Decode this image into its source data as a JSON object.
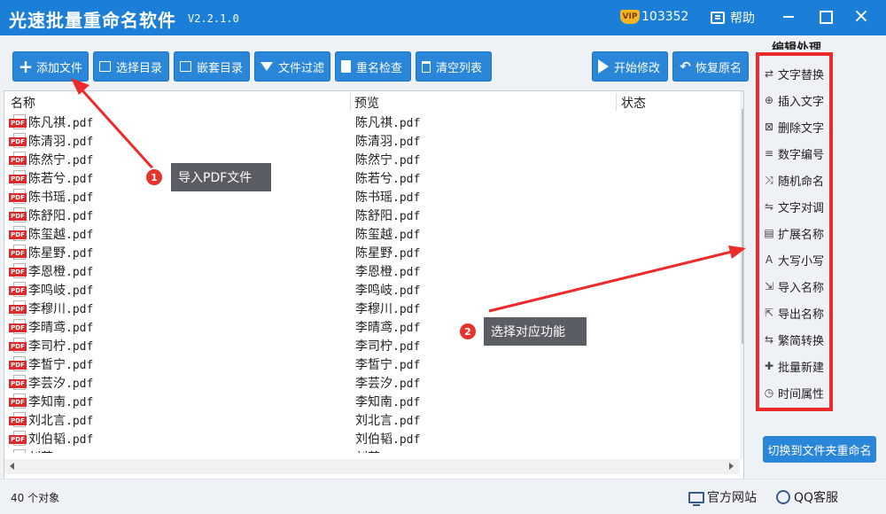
{
  "window": {
    "title": "光速批量重命名软件",
    "version": "V2.2.1.0",
    "vip_badge": "VIP",
    "vip_number": "103352",
    "help_label": "帮助",
    "close_glyph": "×"
  },
  "toolbar": {
    "add_file": "添加文件",
    "select_dir": "选择目录",
    "nested_dir": "嵌套目录",
    "file_filter": "文件过滤",
    "rename_check": "重名检查",
    "clear_list": "清空列表",
    "start_modify": "开始修改",
    "restore_name": "恢复原名",
    "icon_plus": "+",
    "icon_undo": "↶"
  },
  "filelist": {
    "headers": {
      "name": "名称",
      "preview": "预览",
      "status": "状态"
    },
    "file_icon_label": "PDF",
    "rows": [
      {
        "name": "陈凡祺",
        "ext": ".pdf",
        "preview": "陈凡祺",
        "preview_ext": ".pdf"
      },
      {
        "name": "陈清羽",
        "ext": ".pdf",
        "preview": "陈清羽",
        "preview_ext": ".pdf"
      },
      {
        "name": "陈然宁",
        "ext": ".pdf",
        "preview": "陈然宁",
        "preview_ext": ".pdf"
      },
      {
        "name": "陈若兮",
        "ext": ".pdf",
        "preview": "陈若兮",
        "preview_ext": ".pdf"
      },
      {
        "name": "陈书瑶",
        "ext": ".pdf",
        "preview": "陈书瑶",
        "preview_ext": ".pdf"
      },
      {
        "name": "陈舒阳",
        "ext": ".pdf",
        "preview": "陈舒阳",
        "preview_ext": ".pdf"
      },
      {
        "name": "陈玺越",
        "ext": ".pdf",
        "preview": "陈玺越",
        "preview_ext": ".pdf"
      },
      {
        "name": "陈星野",
        "ext": ".pdf",
        "preview": "陈星野",
        "preview_ext": ".pdf"
      },
      {
        "name": "李恩橙",
        "ext": ".pdf",
        "preview": "李恩橙",
        "preview_ext": ".pdf"
      },
      {
        "name": "李鸣岐",
        "ext": ".pdf",
        "preview": "李鸣岐",
        "preview_ext": ".pdf"
      },
      {
        "name": "李穆川",
        "ext": ".pdf",
        "preview": "李穆川",
        "preview_ext": ".pdf"
      },
      {
        "name": "李晴鸢",
        "ext": ".pdf",
        "preview": "李晴鸢",
        "preview_ext": ".pdf"
      },
      {
        "name": "李司柠",
        "ext": ".pdf",
        "preview": "李司柠",
        "preview_ext": ".pdf"
      },
      {
        "name": "李皙宁",
        "ext": ".pdf",
        "preview": "李皙宁",
        "preview_ext": ".pdf"
      },
      {
        "name": "李芸汐",
        "ext": ".pdf",
        "preview": "李芸汐",
        "preview_ext": ".pdf"
      },
      {
        "name": "李知南",
        "ext": ".pdf",
        "preview": "李知南",
        "preview_ext": ".pdf"
      },
      {
        "name": "刘北言",
        "ext": ".pdf",
        "preview": "刘北言",
        "preview_ext": ".pdf"
      },
      {
        "name": "刘伯韬",
        "ext": ".pdf",
        "preview": "刘伯韬",
        "preview_ext": ".pdf"
      },
      {
        "name": "刘茉一",
        "ext": ".pdf",
        "preview": "刘茉一",
        "preview_ext": ".pdf"
      }
    ]
  },
  "right_panel": {
    "title": "编辑处理",
    "functions": [
      {
        "label": "文字替换",
        "icon": "⇄"
      },
      {
        "label": "插入文字",
        "icon": "⊕"
      },
      {
        "label": "删除文字",
        "icon": "⊠"
      },
      {
        "label": "数字编号",
        "icon": "≡"
      },
      {
        "label": "随机命名",
        "icon": "⤨"
      },
      {
        "label": "文字对调",
        "icon": "⇋"
      },
      {
        "label": "扩展名称",
        "icon": "▤"
      },
      {
        "label": "大写小写",
        "icon": "A"
      },
      {
        "label": "导入名称",
        "icon": "⇲"
      },
      {
        "label": "导出名称",
        "icon": "⇱"
      },
      {
        "label": "繁简转换",
        "icon": "⇆"
      },
      {
        "label": "批量新建",
        "icon": "✚"
      },
      {
        "label": "时间属性",
        "icon": "◷"
      }
    ],
    "switch_button": "切换到文件夹重命名"
  },
  "statusbar": {
    "object_count": "40 个对象",
    "official_site": "官方网站",
    "qq_service": "QQ客服"
  },
  "annotations": [
    {
      "number": "1",
      "text": "导入PDF文件"
    },
    {
      "number": "2",
      "text": "选择对应功能"
    }
  ],
  "colors": {
    "title_bar": "#1b7fd8",
    "button": "#2a86d8",
    "highlight_box": "#ee2b2b",
    "callout_bg": "#5a5d63",
    "badge": "#e8332d"
  }
}
